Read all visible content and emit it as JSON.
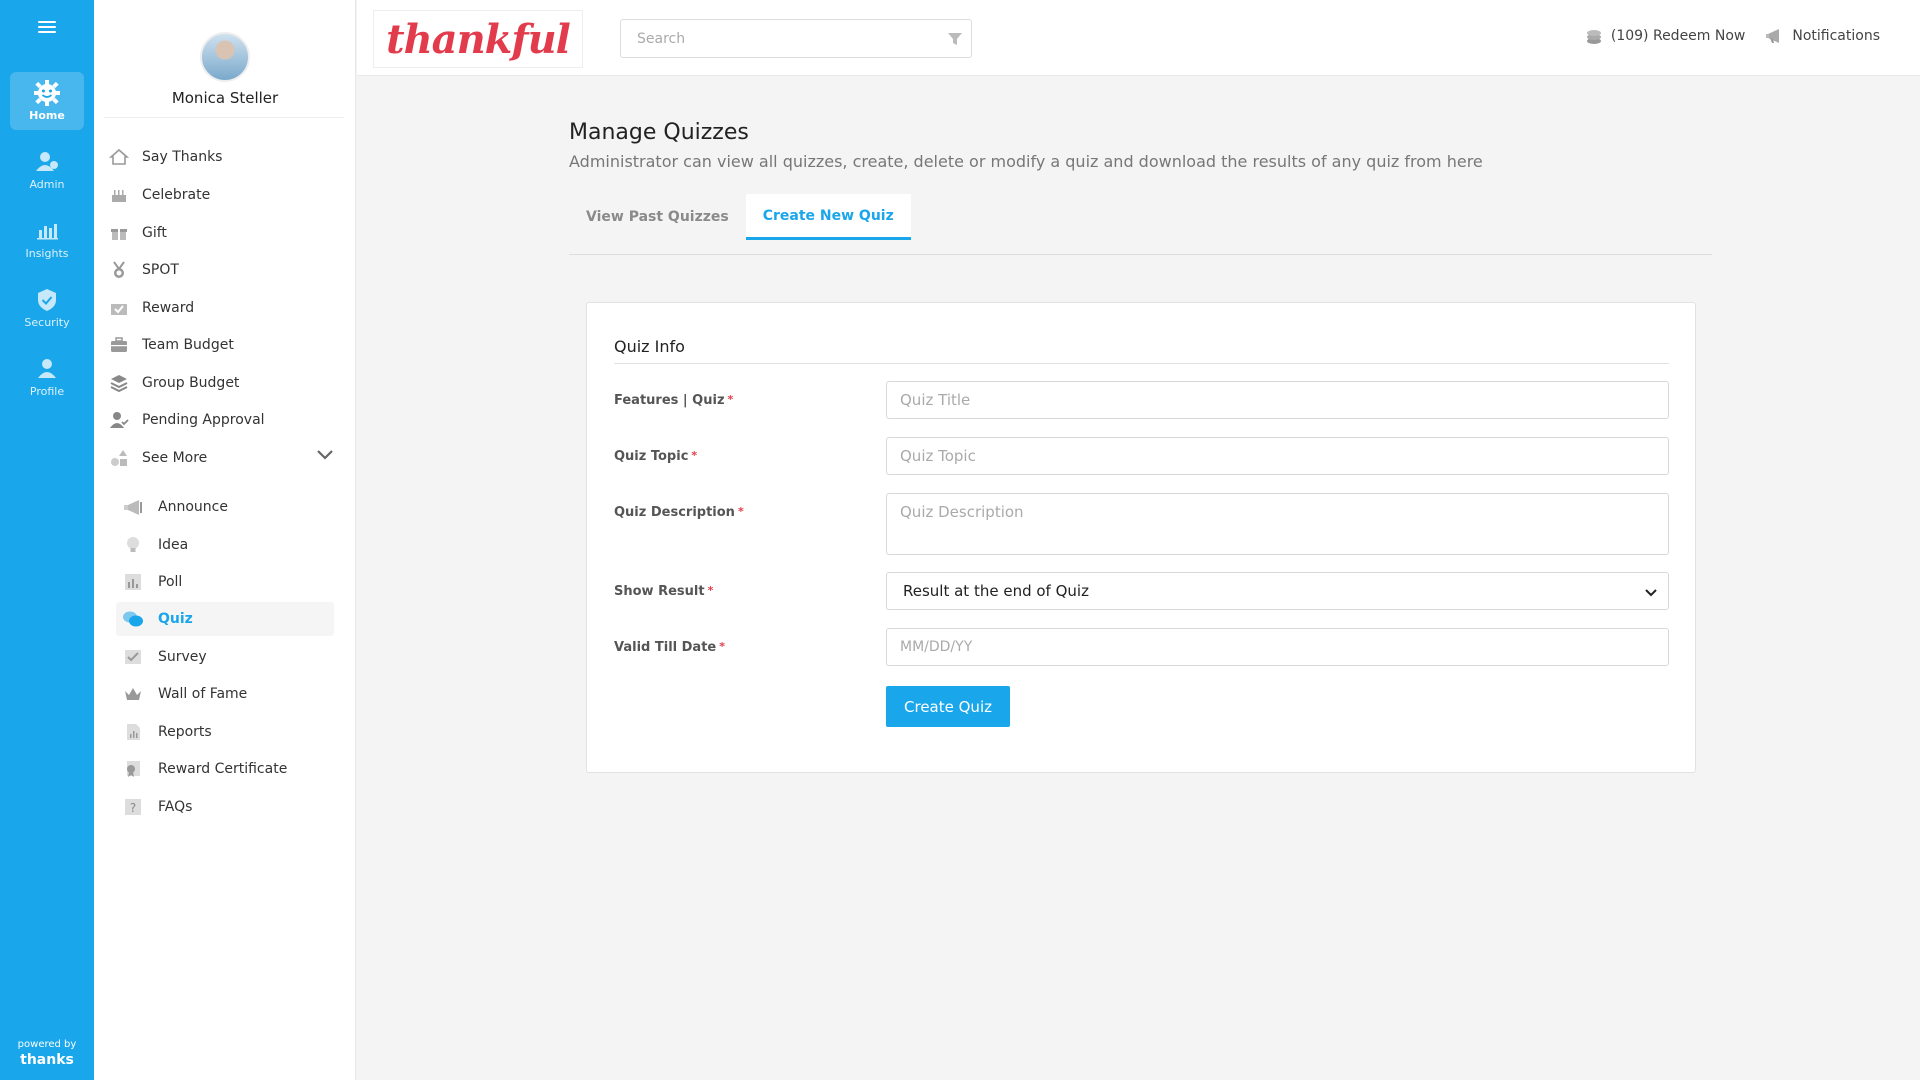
{
  "rail": {
    "items": [
      {
        "label": "Home",
        "icon": "gear-icon",
        "active": true
      },
      {
        "label": "Admin",
        "icon": "admin-user-icon"
      },
      {
        "label": "Insights",
        "icon": "bar-chart-icon"
      },
      {
        "label": "Security",
        "icon": "shield-check-icon"
      },
      {
        "label": "Profile",
        "icon": "person-icon"
      }
    ],
    "powered_by": "powered by",
    "brand": "thanks"
  },
  "sidebar": {
    "user_name": "Monica Steller",
    "items": [
      {
        "label": "Say Thanks",
        "icon": "house-icon"
      },
      {
        "label": "Celebrate",
        "icon": "cake-icon"
      },
      {
        "label": "Gift",
        "icon": "gift-icon"
      },
      {
        "label": "SPOT",
        "icon": "medal-icon"
      },
      {
        "label": "Reward",
        "icon": "reward-icon"
      },
      {
        "label": "Team Budget",
        "icon": "briefcase-icon"
      },
      {
        "label": "Group Budget",
        "icon": "layers-icon"
      },
      {
        "label": "Pending Approval",
        "icon": "user-check-icon"
      },
      {
        "label": "See More",
        "icon": "shapes-icon"
      }
    ],
    "sub_items": [
      {
        "label": "Announce",
        "icon": "megaphone-icon"
      },
      {
        "label": "Idea",
        "icon": "lightbulb-icon"
      },
      {
        "label": "Poll",
        "icon": "poll-icon"
      },
      {
        "label": "Quiz",
        "icon": "chat-bubbles-icon",
        "active": true
      },
      {
        "label": "Survey",
        "icon": "checkbox-icon"
      },
      {
        "label": "Wall of Fame",
        "icon": "crown-icon"
      },
      {
        "label": "Reports",
        "icon": "report-icon"
      },
      {
        "label": "Reward Certificate",
        "icon": "certificate-icon"
      },
      {
        "label": "FAQs",
        "icon": "question-icon"
      }
    ]
  },
  "topbar": {
    "logo_text": "thankful",
    "search_placeholder": "Search",
    "redeem": "(109) Redeem Now",
    "notifications": "Notifications"
  },
  "main": {
    "title": "Manage Quizzes",
    "subtitle": "Administrator can view all quizzes, create, delete or modify a quiz and download the results of any quiz from here",
    "tabs": [
      {
        "label": "View Past Quizzes"
      },
      {
        "label": "Create New Quiz",
        "active": true
      }
    ]
  },
  "form": {
    "section_title": "Quiz Info",
    "required_mark": "*",
    "fields": {
      "title": {
        "label": "Features | Quiz",
        "placeholder": "Quiz Title"
      },
      "topic": {
        "label": "Quiz Topic",
        "placeholder": "Quiz Topic"
      },
      "description": {
        "label": "Quiz Description",
        "placeholder": "Quiz Description"
      },
      "show_result": {
        "label": "Show Result",
        "value": "Result at the end of Quiz"
      },
      "valid_till": {
        "label": "Valid Till Date",
        "placeholder": "MM/DD/YY"
      }
    },
    "submit_label": "Create Quiz"
  },
  "colors": {
    "accent": "#1aa6ea",
    "brand_red": "#e23c4c"
  }
}
